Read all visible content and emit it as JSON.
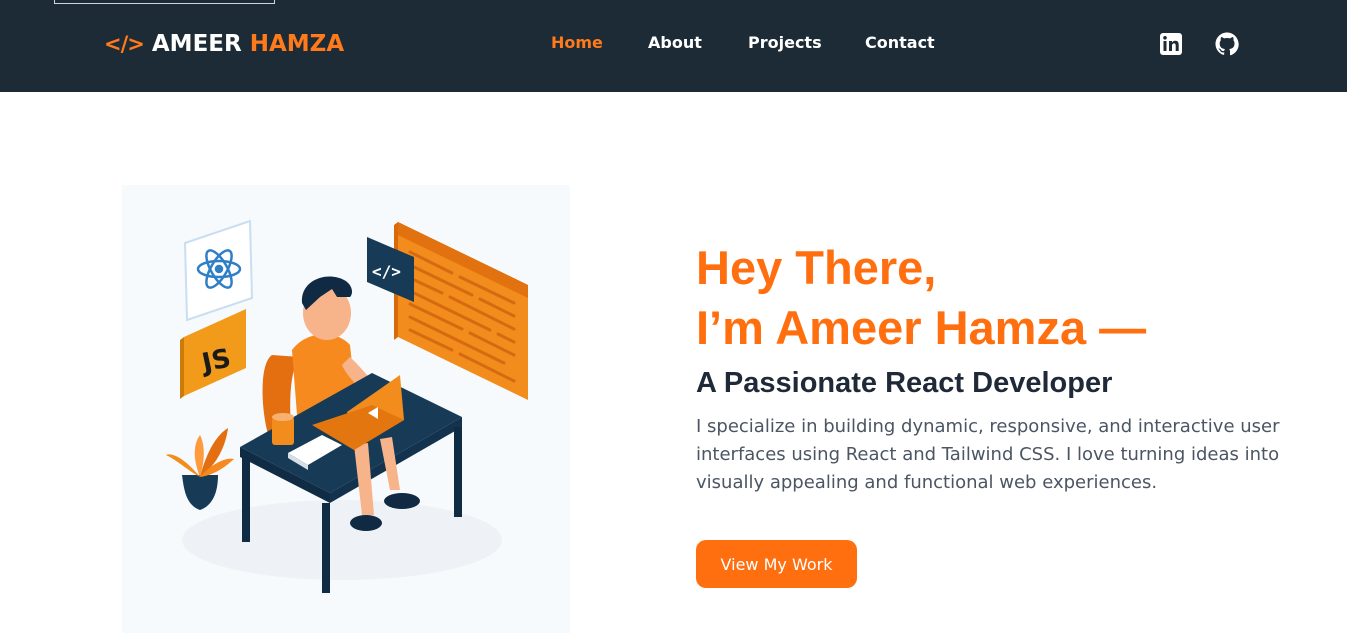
{
  "brand": {
    "icon": "code-icon",
    "icon_text": "</>",
    "first_name": "AMEER",
    "last_name": "HAMZA"
  },
  "nav": {
    "items": [
      {
        "label": "Home",
        "active": true
      },
      {
        "label": "About",
        "active": false
      },
      {
        "label": "Projects",
        "active": false
      },
      {
        "label": "Contact",
        "active": false
      }
    ]
  },
  "social": {
    "linkedin_icon": "linkedin-icon",
    "github_icon": "github-icon"
  },
  "hero": {
    "illustration_badges": {
      "react_icon": "react-icon",
      "js_label": "JS",
      "code_label": "</>"
    },
    "heading_line1": "Hey There,",
    "heading_line2": "I’m Ameer Hamza —",
    "subheading": "A Passionate React Developer",
    "description": "I specialize in building dynamic, responsive, and interactive user interfaces using React and Tailwind CSS. I love turning ideas into visually appealing and functional web experiences.",
    "cta_label": "View My Work"
  },
  "colors": {
    "accent": "#ff6f0f",
    "navbar_bg": "#1c2b35",
    "text_dark": "#1f2937",
    "text_muted": "#4b5563"
  }
}
